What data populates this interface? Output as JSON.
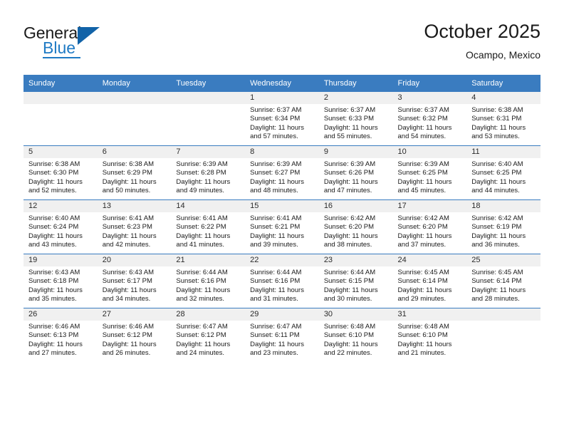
{
  "brand": {
    "line1": "General",
    "line2": "Blue",
    "triangle_color": "#1263a8",
    "blue_color": "#1f7ac4"
  },
  "header": {
    "title": "October 2025",
    "subtitle": "Ocampo, Mexico"
  },
  "theme": {
    "header_blue": "#3a7cc0",
    "day_band_gray": "#f0f0f0",
    "text": "#1a1a1a"
  },
  "weekday_headers": [
    "Sunday",
    "Monday",
    "Tuesday",
    "Wednesday",
    "Thursday",
    "Friday",
    "Saturday"
  ],
  "labels": {
    "sunrise_prefix": "Sunrise:",
    "sunset_prefix": "Sunset:",
    "daylight_prefix": "Daylight:"
  },
  "weeks": [
    [
      {
        "day": "",
        "empty": true
      },
      {
        "day": "",
        "empty": true
      },
      {
        "day": "",
        "empty": true
      },
      {
        "day": "1",
        "sunrise": "Sunrise: 6:37 AM",
        "sunset": "Sunset: 6:34 PM",
        "daylight_1": "Daylight: 11 hours",
        "daylight_2": "and 57 minutes."
      },
      {
        "day": "2",
        "sunrise": "Sunrise: 6:37 AM",
        "sunset": "Sunset: 6:33 PM",
        "daylight_1": "Daylight: 11 hours",
        "daylight_2": "and 55 minutes."
      },
      {
        "day": "3",
        "sunrise": "Sunrise: 6:37 AM",
        "sunset": "Sunset: 6:32 PM",
        "daylight_1": "Daylight: 11 hours",
        "daylight_2": "and 54 minutes."
      },
      {
        "day": "4",
        "sunrise": "Sunrise: 6:38 AM",
        "sunset": "Sunset: 6:31 PM",
        "daylight_1": "Daylight: 11 hours",
        "daylight_2": "and 53 minutes."
      }
    ],
    [
      {
        "day": "5",
        "sunrise": "Sunrise: 6:38 AM",
        "sunset": "Sunset: 6:30 PM",
        "daylight_1": "Daylight: 11 hours",
        "daylight_2": "and 52 minutes."
      },
      {
        "day": "6",
        "sunrise": "Sunrise: 6:38 AM",
        "sunset": "Sunset: 6:29 PM",
        "daylight_1": "Daylight: 11 hours",
        "daylight_2": "and 50 minutes."
      },
      {
        "day": "7",
        "sunrise": "Sunrise: 6:39 AM",
        "sunset": "Sunset: 6:28 PM",
        "daylight_1": "Daylight: 11 hours",
        "daylight_2": "and 49 minutes."
      },
      {
        "day": "8",
        "sunrise": "Sunrise: 6:39 AM",
        "sunset": "Sunset: 6:27 PM",
        "daylight_1": "Daylight: 11 hours",
        "daylight_2": "and 48 minutes."
      },
      {
        "day": "9",
        "sunrise": "Sunrise: 6:39 AM",
        "sunset": "Sunset: 6:26 PM",
        "daylight_1": "Daylight: 11 hours",
        "daylight_2": "and 47 minutes."
      },
      {
        "day": "10",
        "sunrise": "Sunrise: 6:39 AM",
        "sunset": "Sunset: 6:25 PM",
        "daylight_1": "Daylight: 11 hours",
        "daylight_2": "and 45 minutes."
      },
      {
        "day": "11",
        "sunrise": "Sunrise: 6:40 AM",
        "sunset": "Sunset: 6:25 PM",
        "daylight_1": "Daylight: 11 hours",
        "daylight_2": "and 44 minutes."
      }
    ],
    [
      {
        "day": "12",
        "sunrise": "Sunrise: 6:40 AM",
        "sunset": "Sunset: 6:24 PM",
        "daylight_1": "Daylight: 11 hours",
        "daylight_2": "and 43 minutes."
      },
      {
        "day": "13",
        "sunrise": "Sunrise: 6:41 AM",
        "sunset": "Sunset: 6:23 PM",
        "daylight_1": "Daylight: 11 hours",
        "daylight_2": "and 42 minutes."
      },
      {
        "day": "14",
        "sunrise": "Sunrise: 6:41 AM",
        "sunset": "Sunset: 6:22 PM",
        "daylight_1": "Daylight: 11 hours",
        "daylight_2": "and 41 minutes."
      },
      {
        "day": "15",
        "sunrise": "Sunrise: 6:41 AM",
        "sunset": "Sunset: 6:21 PM",
        "daylight_1": "Daylight: 11 hours",
        "daylight_2": "and 39 minutes."
      },
      {
        "day": "16",
        "sunrise": "Sunrise: 6:42 AM",
        "sunset": "Sunset: 6:20 PM",
        "daylight_1": "Daylight: 11 hours",
        "daylight_2": "and 38 minutes."
      },
      {
        "day": "17",
        "sunrise": "Sunrise: 6:42 AM",
        "sunset": "Sunset: 6:20 PM",
        "daylight_1": "Daylight: 11 hours",
        "daylight_2": "and 37 minutes."
      },
      {
        "day": "18",
        "sunrise": "Sunrise: 6:42 AM",
        "sunset": "Sunset: 6:19 PM",
        "daylight_1": "Daylight: 11 hours",
        "daylight_2": "and 36 minutes."
      }
    ],
    [
      {
        "day": "19",
        "sunrise": "Sunrise: 6:43 AM",
        "sunset": "Sunset: 6:18 PM",
        "daylight_1": "Daylight: 11 hours",
        "daylight_2": "and 35 minutes."
      },
      {
        "day": "20",
        "sunrise": "Sunrise: 6:43 AM",
        "sunset": "Sunset: 6:17 PM",
        "daylight_1": "Daylight: 11 hours",
        "daylight_2": "and 34 minutes."
      },
      {
        "day": "21",
        "sunrise": "Sunrise: 6:44 AM",
        "sunset": "Sunset: 6:16 PM",
        "daylight_1": "Daylight: 11 hours",
        "daylight_2": "and 32 minutes."
      },
      {
        "day": "22",
        "sunrise": "Sunrise: 6:44 AM",
        "sunset": "Sunset: 6:16 PM",
        "daylight_1": "Daylight: 11 hours",
        "daylight_2": "and 31 minutes."
      },
      {
        "day": "23",
        "sunrise": "Sunrise: 6:44 AM",
        "sunset": "Sunset: 6:15 PM",
        "daylight_1": "Daylight: 11 hours",
        "daylight_2": "and 30 minutes."
      },
      {
        "day": "24",
        "sunrise": "Sunrise: 6:45 AM",
        "sunset": "Sunset: 6:14 PM",
        "daylight_1": "Daylight: 11 hours",
        "daylight_2": "and 29 minutes."
      },
      {
        "day": "25",
        "sunrise": "Sunrise: 6:45 AM",
        "sunset": "Sunset: 6:14 PM",
        "daylight_1": "Daylight: 11 hours",
        "daylight_2": "and 28 minutes."
      }
    ],
    [
      {
        "day": "26",
        "sunrise": "Sunrise: 6:46 AM",
        "sunset": "Sunset: 6:13 PM",
        "daylight_1": "Daylight: 11 hours",
        "daylight_2": "and 27 minutes."
      },
      {
        "day": "27",
        "sunrise": "Sunrise: 6:46 AM",
        "sunset": "Sunset: 6:12 PM",
        "daylight_1": "Daylight: 11 hours",
        "daylight_2": "and 26 minutes."
      },
      {
        "day": "28",
        "sunrise": "Sunrise: 6:47 AM",
        "sunset": "Sunset: 6:12 PM",
        "daylight_1": "Daylight: 11 hours",
        "daylight_2": "and 24 minutes."
      },
      {
        "day": "29",
        "sunrise": "Sunrise: 6:47 AM",
        "sunset": "Sunset: 6:11 PM",
        "daylight_1": "Daylight: 11 hours",
        "daylight_2": "and 23 minutes."
      },
      {
        "day": "30",
        "sunrise": "Sunrise: 6:48 AM",
        "sunset": "Sunset: 6:10 PM",
        "daylight_1": "Daylight: 11 hours",
        "daylight_2": "and 22 minutes."
      },
      {
        "day": "31",
        "sunrise": "Sunrise: 6:48 AM",
        "sunset": "Sunset: 6:10 PM",
        "daylight_1": "Daylight: 11 hours",
        "daylight_2": "and 21 minutes."
      },
      {
        "day": "",
        "empty": true
      }
    ]
  ]
}
